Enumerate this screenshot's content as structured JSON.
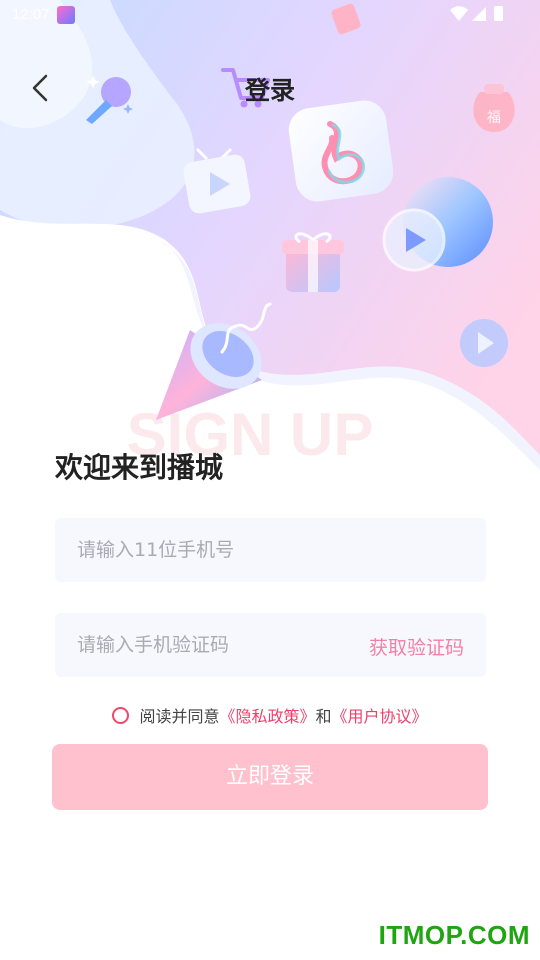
{
  "status_bar": {
    "time": "12:07"
  },
  "nav": {
    "title": "登录"
  },
  "welcome_text": "欢迎来到播城",
  "phone_input": {
    "placeholder": "请输入11位手机号",
    "value": ""
  },
  "code_input": {
    "placeholder": "请输入手机验证码",
    "value": ""
  },
  "get_code_label": "获取验证码",
  "agreement": {
    "checked": false,
    "prefix": "阅读并同意",
    "privacy_link": "《隐私政策》",
    "and": "和",
    "terms_link": "《用户协议》"
  },
  "login_button_label": "立即登录",
  "hero_watermark_text": "SIGN UP",
  "watermark": "ITMOP.COM",
  "colors": {
    "accent": "#ef3f6a",
    "login_button_disabled": "#ffc1cd",
    "get_code": "#f081a6",
    "field_bg": "#f7f8fd",
    "watermark": "#1fa512"
  },
  "icons": [
    "back-chevron-icon",
    "microphone-icon",
    "shopping-cart-icon",
    "tv-play-icon",
    "music-note-app-icon",
    "gift-icon",
    "play-circle-icon",
    "megaphone-icon",
    "money-bag-icon",
    "red-envelope-icon",
    "wifi-icon",
    "signal-icon",
    "battery-icon"
  ]
}
